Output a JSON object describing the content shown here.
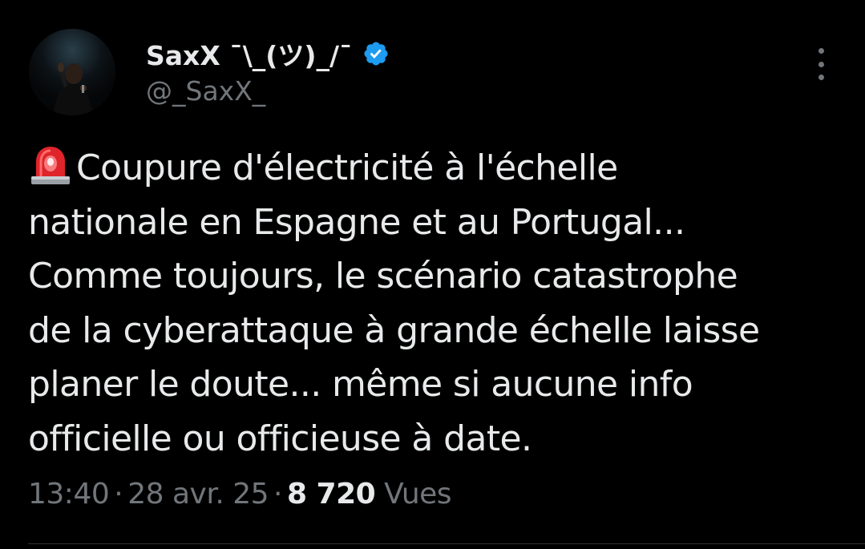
{
  "tweet": {
    "author": {
      "display_name": "SaxX ¯\\_(ツ)_/¯",
      "handle": "@_SaxX_",
      "verified": true,
      "verified_color": "#1d9bf0"
    },
    "text_emoji": "siren-icon",
    "text_lines": [
      "Coupure d'électricité à l'échelle",
      "nationale en Espagne et au Portugal...",
      "Comme toujours, le scénario catastrophe",
      "de la cyberattaque à grande échelle laisse",
      "planer le doute... même si aucune info",
      "officielle ou officieuse à date."
    ],
    "time": "13:40",
    "separator": "·",
    "date": "28 avr. 25",
    "views_count": "8 720",
    "views_label": "Vues"
  },
  "colors": {
    "background": "#000000",
    "primary_text": "#e7e9ea",
    "secondary_text": "#71767b"
  }
}
